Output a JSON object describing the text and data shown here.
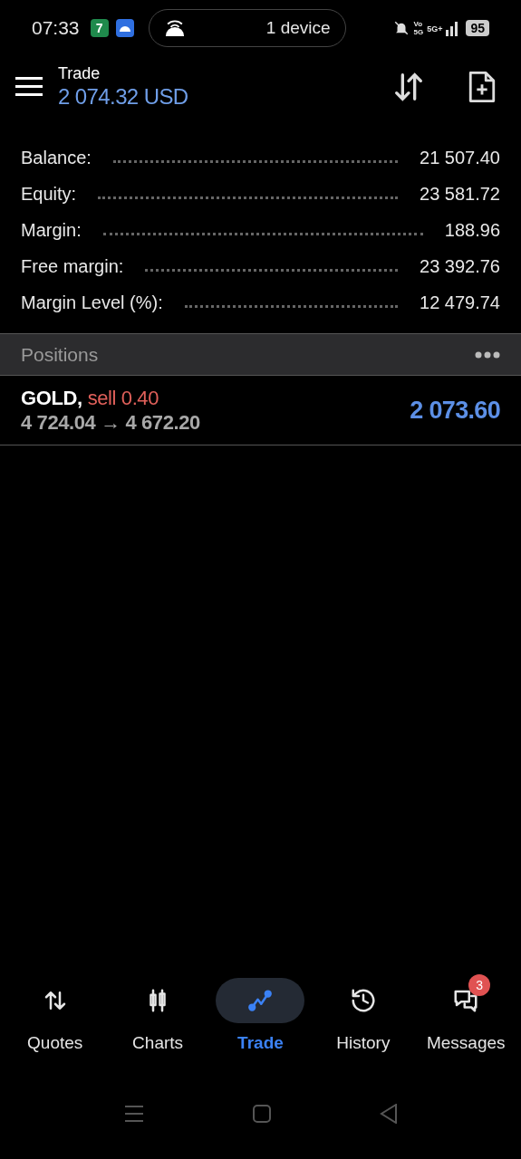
{
  "status_bar": {
    "time": "07:33",
    "app_badge": "7",
    "hotspot": "1 device",
    "volte": [
      "Vo",
      "5G"
    ],
    "network": "5G+",
    "battery": "95"
  },
  "header": {
    "title": "Trade",
    "balance": "2 074.32 USD"
  },
  "summary": [
    {
      "label": "Balance:",
      "value": "21 507.40"
    },
    {
      "label": "Equity:",
      "value": "23 581.72"
    },
    {
      "label": "Margin:",
      "value": "188.96"
    },
    {
      "label": "Free margin:",
      "value": "23 392.76"
    },
    {
      "label": "Margin Level (%):",
      "value": "12 479.74"
    }
  ],
  "positions": {
    "title": "Positions",
    "rows": [
      {
        "symbol": "GOLD,",
        "side": "sell 0.40",
        "prices": "4 724.04 → 4 672.20",
        "profit": "2 073.60"
      }
    ]
  },
  "bottom_nav": [
    {
      "label": "Quotes",
      "kind": "quotes",
      "selected": false
    },
    {
      "label": "Charts",
      "kind": "charts",
      "selected": false
    },
    {
      "label": "Trade",
      "kind": "trade",
      "selected": true
    },
    {
      "label": "History",
      "kind": "history",
      "selected": false
    },
    {
      "label": "Messages",
      "kind": "messages",
      "selected": false,
      "badge": "3"
    }
  ]
}
